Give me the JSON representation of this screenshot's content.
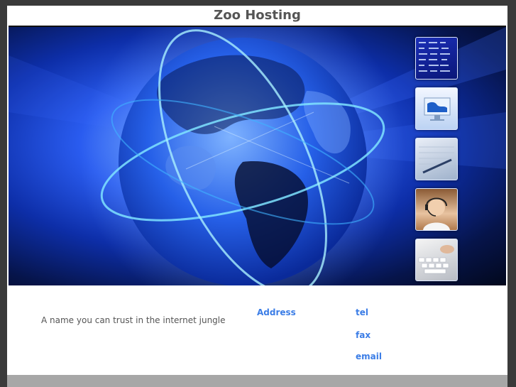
{
  "header": {
    "title": "Zoo Hosting"
  },
  "hero": {
    "image": "globe-network-icon",
    "thumbnails": [
      {
        "icon": "stock-ticker-icon"
      },
      {
        "icon": "world-map-monitor-icon"
      },
      {
        "icon": "pen-document-icon"
      },
      {
        "icon": "support-headset-icon"
      },
      {
        "icon": "keyboard-icon"
      }
    ]
  },
  "footer": {
    "tagline": "A name you can trust in the internet jungle",
    "address_label": "Address",
    "tel_label": "tel",
    "fax_label": "fax",
    "email_label": "email"
  },
  "colors": {
    "link": "#3b7de6",
    "title": "#555555",
    "frame": "#3a3a3a"
  }
}
